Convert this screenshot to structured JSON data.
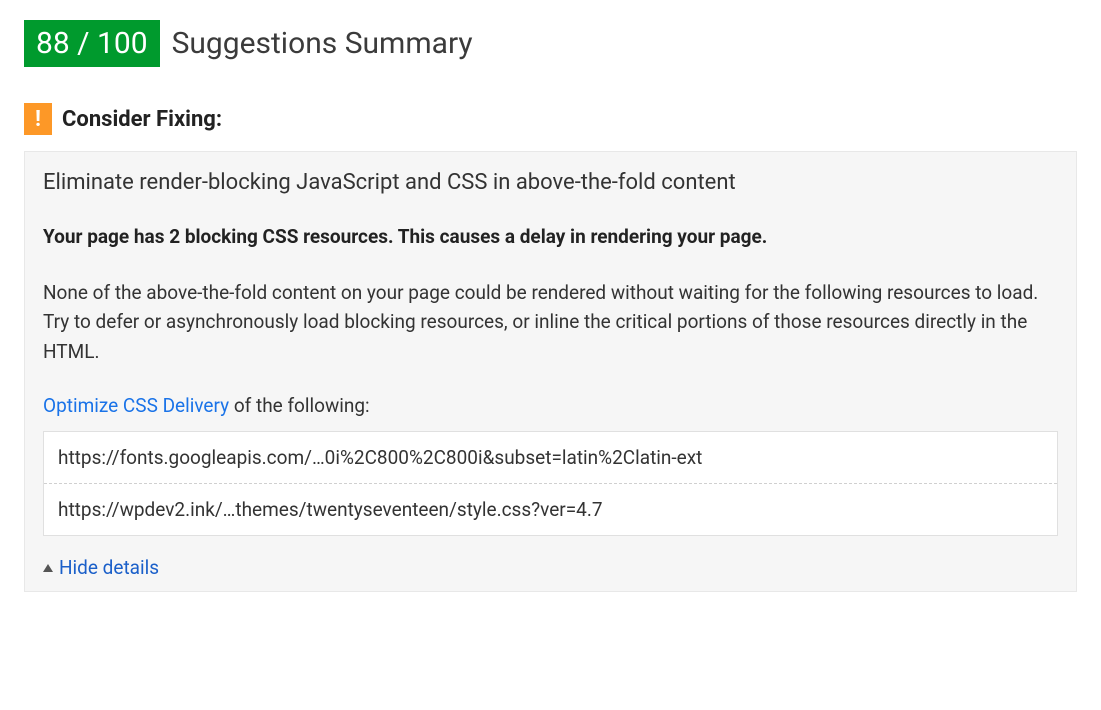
{
  "header": {
    "score": "88 / 100",
    "title": "Suggestions Summary"
  },
  "warning": {
    "icon_text": "!",
    "label": "Consider Fixing:"
  },
  "suggestion": {
    "title": "Eliminate render-blocking JavaScript and CSS in above-the-fold content",
    "impact": "Your page has 2 blocking CSS resources. This causes a delay in rendering your page.",
    "description": "None of the above-the-fold content on your page could be rendered without waiting for the following resources to load. Try to defer or asynchronously load blocking resources, or inline the critical portions of those resources directly in the HTML.",
    "optimize_link_text": "Optimize CSS Delivery",
    "optimize_suffix": " of the following:",
    "resources": [
      "https://fonts.googleapis.com/…0i%2C800%2C800i&subset=latin%2Clatin-ext",
      "https://wpdev2.ink/…themes/twentyseventeen/style.css?ver=4.7"
    ],
    "toggle_label": "Hide details"
  }
}
